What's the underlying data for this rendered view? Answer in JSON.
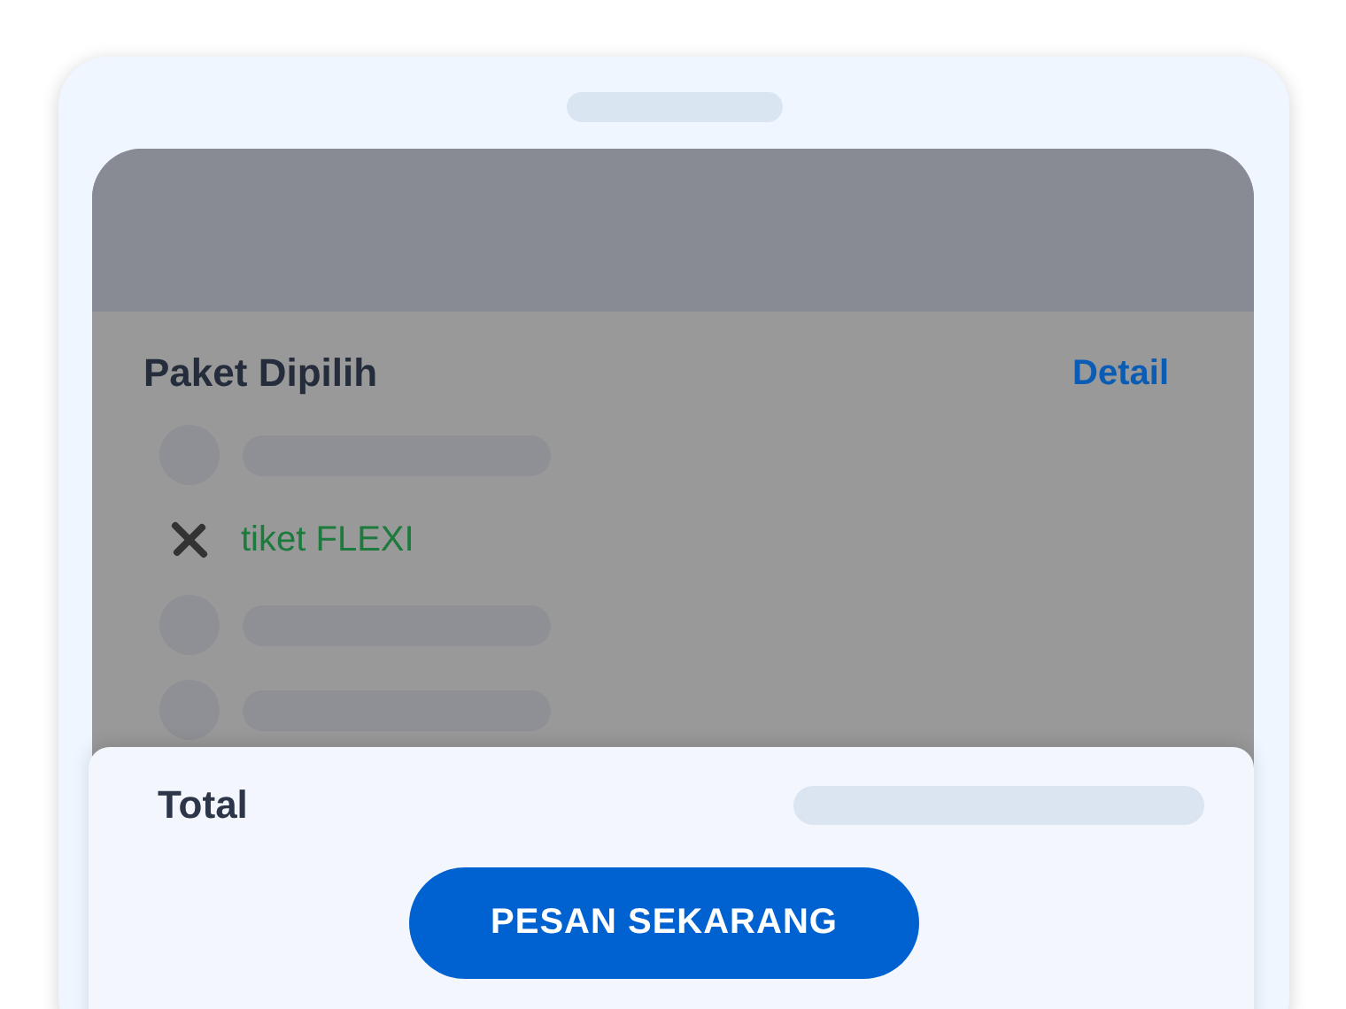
{
  "package": {
    "title": "Paket Dipilih",
    "detail_link": "Detail",
    "items": [
      {
        "kind": "skeleton"
      },
      {
        "kind": "item",
        "label": "tiket FLEXI"
      },
      {
        "kind": "skeleton"
      },
      {
        "kind": "skeleton"
      }
    ]
  },
  "summary": {
    "label": "Total",
    "button": "PESAN SEKARANG"
  }
}
